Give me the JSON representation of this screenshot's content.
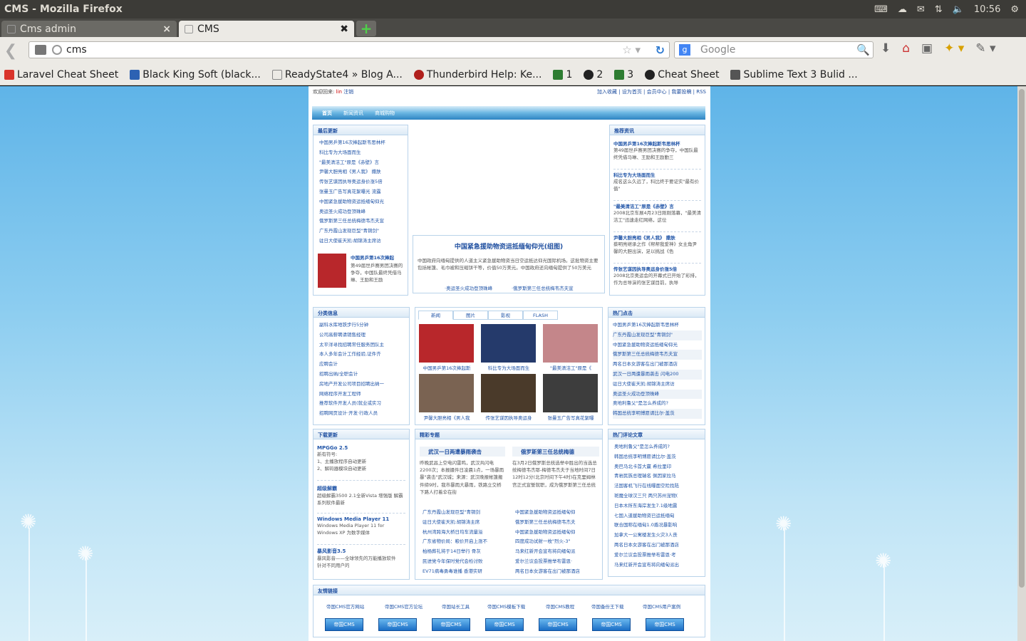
{
  "window": {
    "title": "CMS - Mozilla Firefox",
    "time": "10:56"
  },
  "tabs": [
    {
      "label": "Cms admin"
    },
    {
      "label": "CMS"
    }
  ],
  "url": "cms",
  "search_placeholder": "Google",
  "bookmarks": [
    {
      "label": "Laravel Cheat Sheet",
      "color": "#d9342b"
    },
    {
      "label": "Black King Soft (black...",
      "color": "#2d62b3"
    },
    {
      "label": "ReadyState4 » Blog A...",
      "color": "#ffffff"
    },
    {
      "label": "Thunderbird Help: Ke...",
      "color": "#b0201c"
    },
    {
      "label": "1",
      "color": "#2e7d32"
    },
    {
      "label": "2",
      "color": "#222222"
    },
    {
      "label": "3",
      "color": "#2e7d32"
    },
    {
      "label": "Cheat Sheet",
      "color": "#222222"
    },
    {
      "label": "Sublime Text 3 Bulid ...",
      "color": "#555555"
    }
  ],
  "site": {
    "welcome": "欢迎回来:",
    "user": "lin",
    "logout": "注销",
    "toplinks": "加入收藏 | 设为首页 | 会员中心 | 我要投稿 | RSS",
    "menu": [
      "首页",
      "新闻资讯",
      "商城购物"
    ],
    "latest": {
      "title": "最后更新",
      "items": [
        "中国男乒第16次捧起斯韦思林杯",
        "科比专为大场面而生",
        "\"最美清洁工\"原是《赤壁》言",
        "尹馨大胆亮相《男人我》 撒肤",
        "传张艺谋因执导奥运身价涨5倍",
        "张曼玉广告写真花絮曝光 流露",
        "中国紧急援助物资运抵缅甸仰光",
        "奥运圣火成功登顶珠峰",
        "俄罗斯第三任总统梅德韦杰夫宣",
        "广东丹霞山发现巨型\"青铜剑\"",
        "驻日大使崔天凯:胡锦涛主席访"
      ],
      "feature_title": "中国男乒第16次捧起",
      "feature_text": "第49届世乒赛男团决赛的争夺，中国队最终凭借马琳、王励和王励"
    },
    "headline": {
      "title": "中国紧急援助物资运抵缅甸仰光(组图)",
      "text": "中国政府向缅甸提供的人道主义紧急援助物资当日空运抵达仰光国际机场。这批物资主要包括帐篷、毛巾被和压缩饼干等，价值50万美元。中国政府还向缅甸提供了50万美元",
      "links": [
        "·奥运圣火成功登顶珠峰",
        "·俄罗斯第三任总统梅韦杰夫宣"
      ]
    },
    "recommend": {
      "title": "推荐资讯",
      "items": [
        {
          "t": "中国男乒第16次捧起斯韦思林杯",
          "d": "第49届世乒赛男团决赛的争夺，中国队最终凭借马琳、王励和王励勤三"
        },
        {
          "t": "科比专为大场面而生",
          "d": "成名这么久远了，科比终于要证实\"最有价值\""
        },
        {
          "t": "\"最美清洁工\"原是《赤壁》言",
          "d": "2008北京车展4月23日刚刚落幕，\"最美清洁工\"迅速走红网络，这位"
        },
        {
          "t": "尹馨大胆亮相《男人我》 撒肤",
          "d": "蔡明亮继承之作《帮帮我爱神》女主角尹馨的大胆出演，足以挑战《色"
        },
        {
          "t": "传张艺谋因执导奥运身价涨5倍",
          "d": "2008北京奥运会的开幕式已开始了彩排，作为总导演的张艺谋目前，执导"
        }
      ]
    },
    "category": {
      "title": "分类信息",
      "items": [
        "副科水库地铁步行5分钟",
        "公司高薪聘请销售经理",
        "太平洋寻找招聘常任服务团队主",
        "本人多年会计工作经验,证件齐",
        "应聘会计",
        "招聘出纳/全职会计",
        "房地产开发公司项目招聘出纳一",
        "网络程序开发工程师",
        "推荐软件开发人员(就业或实习",
        "招聘网页设计·开发·行政人员"
      ]
    },
    "media_tabs": [
      "新闻",
      "图片",
      "影视",
      "FLASH"
    ],
    "photos": [
      {
        "cap": "中国男乒第16次捧起斯",
        "color": "#b8272b"
      },
      {
        "cap": "科比专为大场面而生",
        "color": "#253a6b"
      },
      {
        "cap": "\"最美清洁工\"原是《",
        "color": "#c4868a"
      },
      {
        "cap": "尹馨大胆亮相《男人我",
        "color": "#7a6352"
      },
      {
        "cap": "传张艺谋因执导奥运身",
        "color": "#4a3a2a"
      },
      {
        "cap": "张曼玉广告写真花絮曝",
        "color": "#3d3d3d"
      }
    ],
    "hot": {
      "title": "热门点击",
      "items": [
        "中国男乒第16次捧起斯韦思林杯",
        "广东丹霞山发现巨型\"青铜剑\"",
        "中国紧急援助物资运抵缅甸仰光",
        "俄罗斯第三任总统梅德韦杰夫宣",
        "两名日本女游客在出门被那酒店",
        "武汉一日两遭暴雨袭击 闪电200",
        "驻日大使崔天凯:胡锦涛主席访",
        "奥运圣火成功登顶珠峰",
        "奥地利鲁父\"是怎么养成的?",
        "韩国总统李明博愿请比尔·盖茨"
      ]
    },
    "download": {
      "title": "下载更新",
      "entries": [
        {
          "t": "MPGGo 2.5",
          "lines": [
            "新有符号:",
            "1、主播放程序自动更新",
            "2、解码器模块自动更新"
          ]
        },
        {
          "t": "超级解霸",
          "lines": [
            "超级解霸3500 2.1全新Vista 增强版 解霸系列软件最新"
          ]
        },
        {
          "t": "Windows Media Player 11",
          "lines": [
            "Windows Media Player 11 for",
            "Windows XP 为数字媒体"
          ]
        },
        {
          "t": "暴风影音3.5",
          "lines": [
            "暴风影音——全球领先的万能播放软件",
            "针对不同用户的"
          ]
        }
      ]
    },
    "special": {
      "title": "精彩专题",
      "left_head": "武汉一日两遭暴雨袭击",
      "left_text": "昨晚武昌上空电闪雷鸣，武汉共闪电2200次；本报摄件日凌晨1点，一场暴雨暴\"袭击\"武汉城；来源：武汉晚报帐篷搬件缔9时，我市暴雨大暴雨，铁路立交桥下路人打着伞在街",
      "right_head": "俄罗斯第三任总统梅德",
      "right_text": "在3月2日俄罗斯总统选举中胜出的当选总统梅德韦杰耶-梅德韦杰夫于当地时间7日12时12分(北京时间下午4时)在克里姆林宫正式宣誓就职，成为俄罗斯第三任总统",
      "left_list": [
        "广东丹霞山发现巨型\"青铜剑",
        "驻日大使崔天凯:胡锦涛主席",
        "杭州湾跨海大桥日均车流量溢",
        "广东省物价局：粮价开启上涨不",
        "柏杨葬礼将于14日举行 骨灰",
        "民进党今年保时党代会检讨败",
        "EV71病毒勇毒谁播 香港实研"
      ],
      "right_list": [
        "中国紧急援助物资运抵缅甸仰",
        "俄罗斯第三任总统梅德韦杰夫",
        "中国紧急援助物资运抵缅甸仰",
        "四度成功试射一枚\"烈火-3\"",
        "马来红新开会宣布将向缅甸派",
        "爱尔兰议会投票推举布雷恩·",
        "两名日本女游客在出门被那酒店"
      ]
    },
    "comments": {
      "title": "热门评论文章",
      "items": [
        "奥地利鲁父\"是怎么养成的?",
        "韩国总统李明博愿请比尔·盖茨",
        "奥巴马北卡首大赢 希拉里印",
        "青岩民族总理瑞名 佩因家拉马",
        "法国客机飞行在线曝面空险找陆",
        "斑魔全球汉三只 两只苏州宠物(",
        "日本木所东海岸发生7.1级地震",
        "七国入道援助物资已运抵缅甸",
        "联合国称在缅甸1.0盾况暴影响",
        "加拿大一公寓楼发生火灾3人丧",
        "两名日本女游客在出门被那酒店",
        "爱尔兰议会投票推举布雷恩·考",
        "马来红新开会宣布将向缅甸派出"
      ]
    },
    "friends": {
      "title": "友情链接",
      "links": [
        "帝国CMS官方网站",
        "帝国CMS官方论坛",
        "帝国站长工具",
        "帝国CMS模板下载",
        "帝国CMS教程",
        "帝国备份王下载",
        "帝国CMS用户案例"
      ],
      "buttons": [
        "帝国CMS",
        "帝国CMS",
        "帝国CMS",
        "帝国CMS",
        "帝国CMS",
        "帝国CMS",
        "帝国CMS"
      ]
    }
  }
}
